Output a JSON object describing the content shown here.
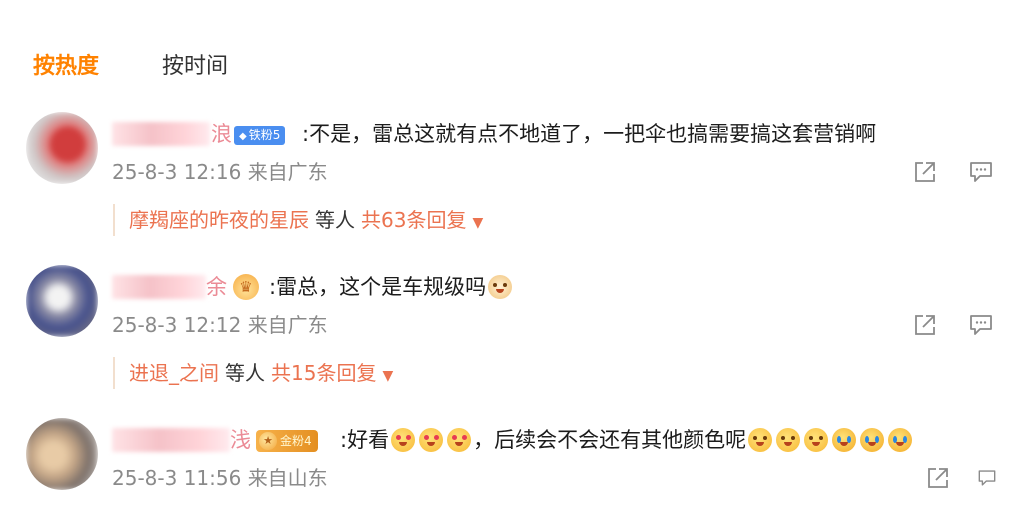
{
  "sort": {
    "hot": "按热度",
    "time": "按时间"
  },
  "comments": [
    {
      "name_tail": "浪",
      "badge": "铁粉5",
      "text": ":不是，雷总这就有点不地道了，一把伞也搞需要搞这套营销啊",
      "time": "25-8-3 12:16",
      "location": "来自广东",
      "reply": {
        "who": "摩羯座的昨夜的星辰",
        "etc": "等人",
        "total": "共63条回复"
      }
    },
    {
      "name_tail": "余",
      "text_before": ":雷总，这个是车规级吗",
      "time": "25-8-3 12:12",
      "location": "来自广东",
      "reply": {
        "who": "进退_之间",
        "etc": "等人",
        "total": "共15条回复"
      }
    },
    {
      "name_tail": "浅",
      "badge": "金粉4",
      "text_before": ":好看",
      "text_middle": "，后续会不会还有其他颜色呢",
      "time": "25-8-3 11:56",
      "location": "来自山东"
    }
  ],
  "icons": {
    "share": "share-icon",
    "comment": "comment-icon",
    "expand": "triangle-down-icon",
    "diamond": "diamond-icon"
  },
  "colors": {
    "accent": "#ff8200",
    "link": "#eb7350",
    "meta": "#8a8a8a",
    "fan_badge": "#4a8ef0",
    "gold_badge": "#f0a43a"
  }
}
